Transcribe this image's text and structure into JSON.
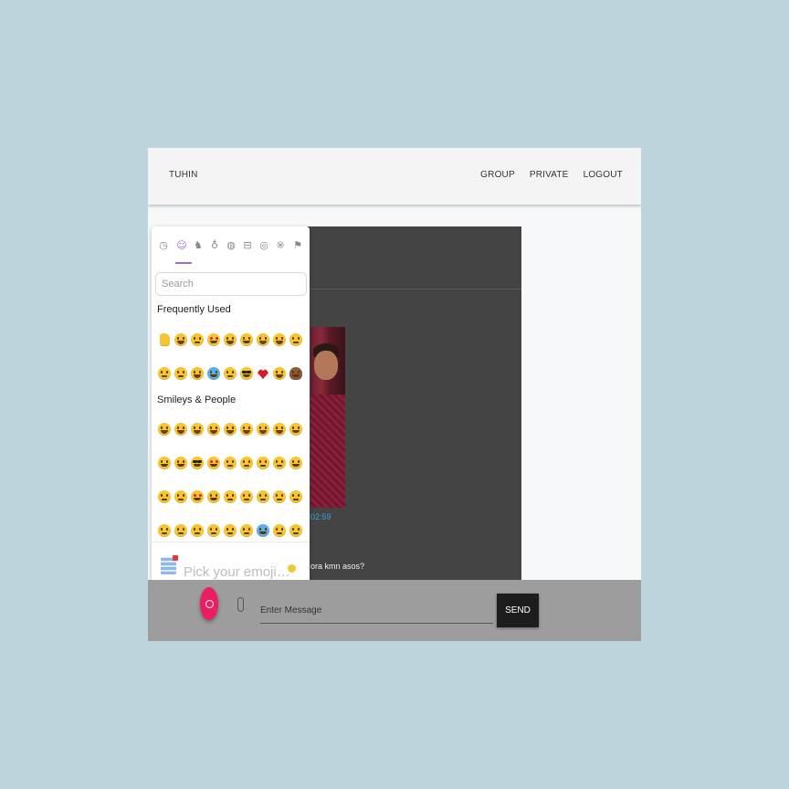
{
  "navbar": {
    "brand": "TUHIN",
    "links": [
      "GROUP",
      "PRIVATE",
      "LOGOUT"
    ]
  },
  "emoji_picker": {
    "categories": [
      "recent-icon",
      "smileys-icon",
      "animals-icon",
      "food-icon",
      "travel-icon",
      "activity-icon",
      "objects-icon",
      "symbols-icon",
      "flags-icon"
    ],
    "active_category": "smileys-icon",
    "search_placeholder": "Search",
    "sections": [
      {
        "title": "Frequently Used",
        "emojis": [
          "👍",
          "😀",
          "😘",
          "😍",
          "😆",
          "😜",
          "😅",
          "😂",
          "😱",
          "😞",
          "😢",
          "😩",
          "😭",
          "😏",
          "😎",
          "❤️",
          "😁",
          "💩"
        ]
      },
      {
        "title": "Smileys & People",
        "emojis": [
          "😀",
          "😃",
          "😄",
          "😆",
          "😁",
          "😅",
          "😂",
          "🤣",
          "😊",
          "😇",
          "🙂",
          "😍",
          "😘",
          "😗",
          "😙",
          "😚",
          "😋",
          "😛",
          "😜",
          "😝",
          "🤗",
          "😐",
          "😑",
          "😶",
          "🙄",
          "😏",
          "😣",
          "😥",
          "😮",
          "😯",
          "😫",
          "😴"
        ]
      }
    ],
    "footer_label": "Pick your emoji…",
    "colors": {
      "accent": "#9b6fd0",
      "emoji": "#f7c531"
    }
  },
  "chat": {
    "timestamp": "02:59",
    "message_fragment": "ora kmn asos?"
  },
  "composer": {
    "message_placeholder": "Enter Message",
    "send_label": "SEND",
    "fab_color": "#ec1e63"
  }
}
